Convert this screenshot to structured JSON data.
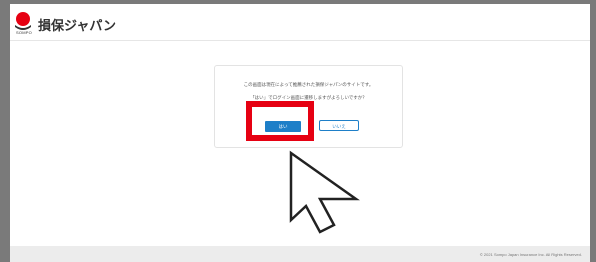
{
  "header": {
    "brand": "損保ジャパン",
    "logo_sub": "SOMPO",
    "logo_icon": "sompo-logo-icon"
  },
  "dialog": {
    "message1": "この画面は現在によって推薦された損保ジャパンのサイトです。",
    "message2": "「はい」でログイン画面に遷移しますがよろしいですか？",
    "yes_label": "はい",
    "no_label": "いいえ"
  },
  "footer": {
    "copyright": "© 2021 Sompo Japan Insurance Inc. All Rights Reserved."
  },
  "annotation": {
    "highlight_color": "#e60012",
    "cursor_icon": "arrow-cursor-icon"
  },
  "colors": {
    "accent": "#1e7fc8",
    "brand_red": "#e60012"
  }
}
